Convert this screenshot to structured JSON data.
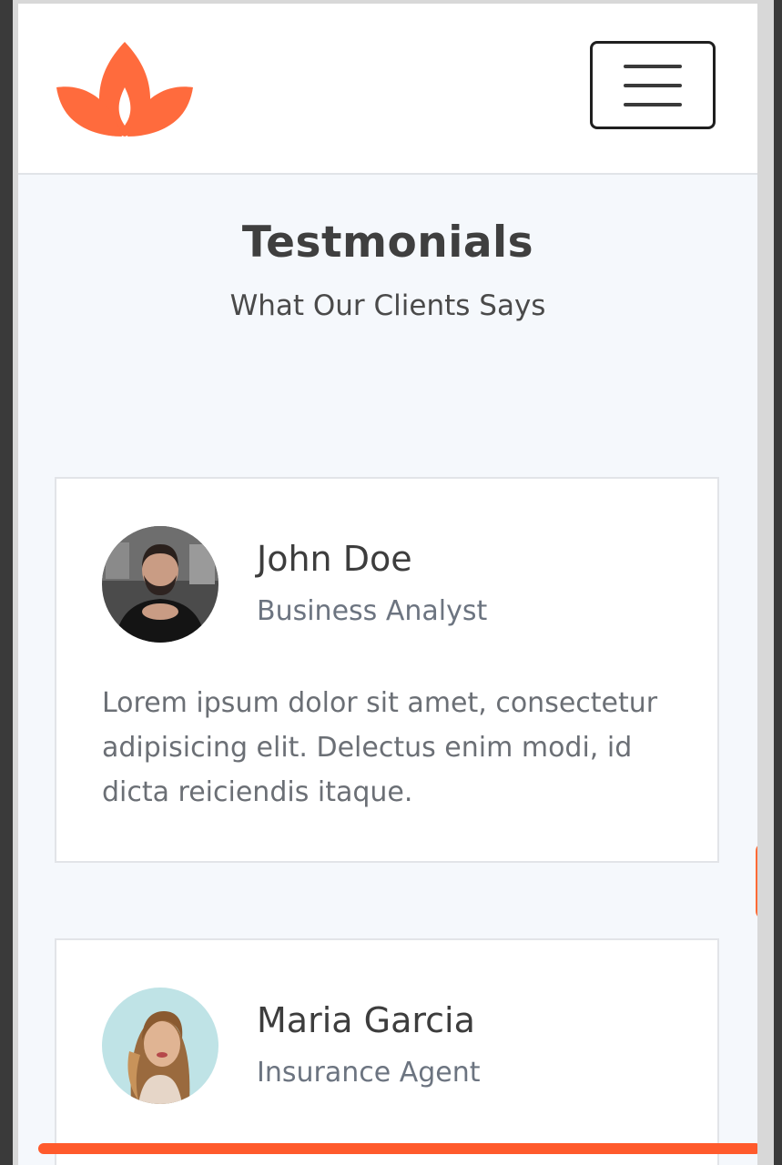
{
  "header": {
    "logo_icon": "lotus-logo",
    "menu_icon": "hamburger-menu-icon"
  },
  "section": {
    "title": "Testmonials",
    "subtitle": "What Our Clients Says"
  },
  "testimonials": [
    {
      "name": "John Doe",
      "role": "Business Analyst",
      "quote": "Lorem ipsum dolor sit amet, consectetur adipisicing elit. Delectus enim modi, id dicta reiciendis itaque."
    },
    {
      "name": "Maria Garcia",
      "role": "Insurance Agent"
    }
  ],
  "colors": {
    "accent": "#ff6a35",
    "page_background": "#f5f8fc",
    "card_background": "#ffffff"
  }
}
